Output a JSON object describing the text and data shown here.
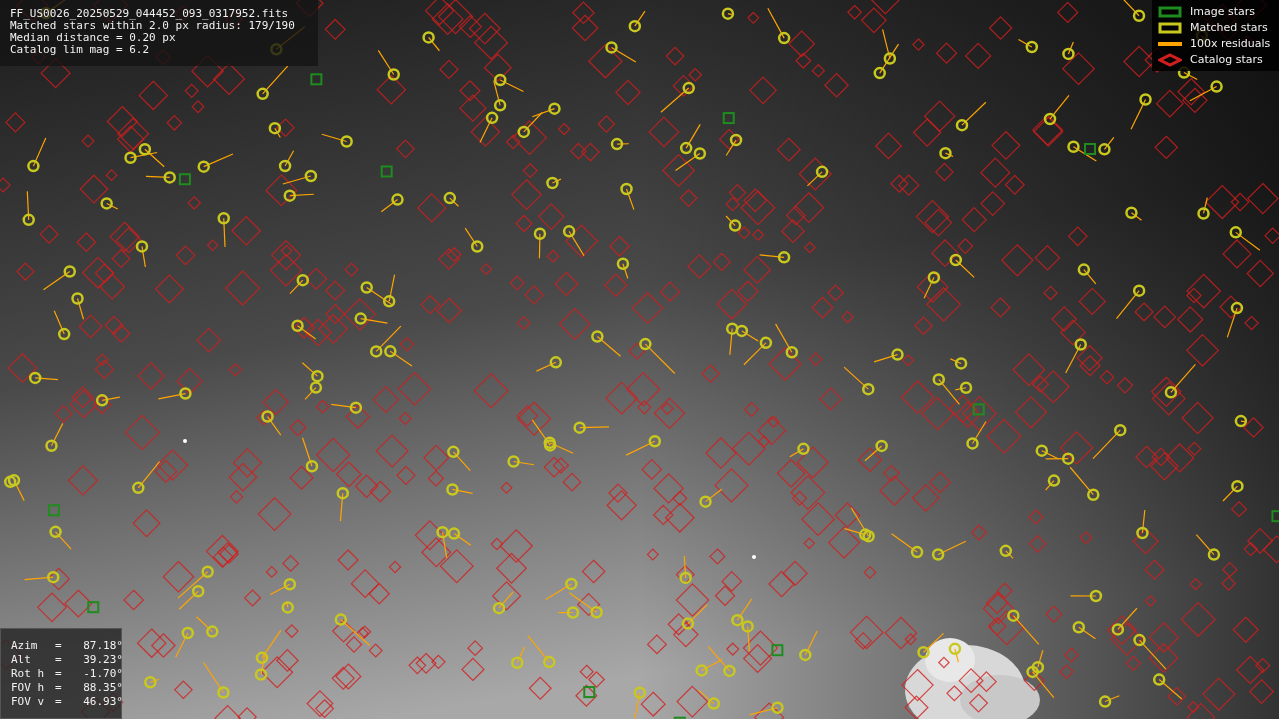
{
  "info_panel": {
    "lines": [
      "FF_US0026_20250529_044452_093_0317952.fits",
      "Matched stars within 2.0 px radius: 179/190",
      "Median distance = 0.20 px",
      "Catalog lim mag = 6.2"
    ]
  },
  "legend": [
    {
      "label": "Image stars",
      "color": "#1e8c1e"
    },
    {
      "kind": "matched",
      "label": "Matched stars",
      "color": "#c8c81e"
    },
    {
      "kind": "residual",
      "label": "100x residuals",
      "color": "#ffa500"
    },
    {
      "kind": "catalog",
      "label": "Catalog stars",
      "color": "#d21e1e"
    }
  ],
  "pointing": [
    {
      "label": "Azim",
      "sep": "=",
      "value": "87.18°"
    },
    {
      "label": "Alt",
      "sep": "=",
      "value": "39.23°"
    },
    {
      "label": "Rot h",
      "sep": "=",
      "value": "-1.70°"
    },
    {
      "label": "FOV h",
      "sep": "=",
      "value": "88.35°"
    },
    {
      "label": "FOV v",
      "sep": "=",
      "value": "46.93°"
    }
  ]
}
